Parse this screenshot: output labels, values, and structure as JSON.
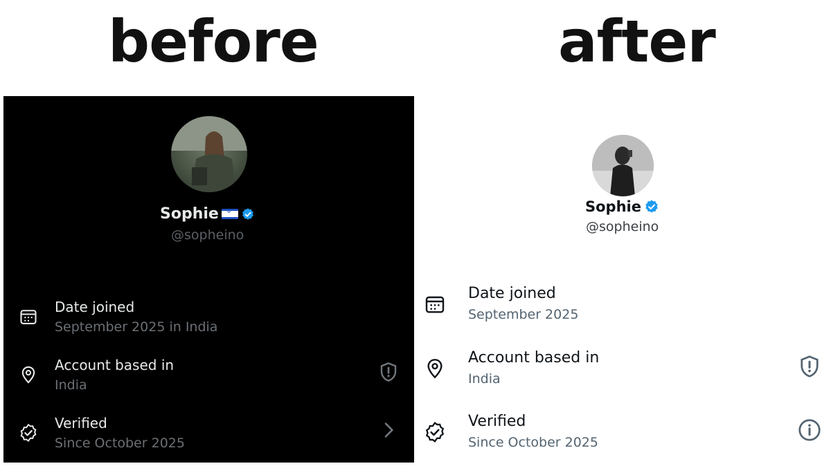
{
  "headings": {
    "before": "before",
    "after": "after"
  },
  "before": {
    "name": "Sophie",
    "flag_icon": "israel-flag-icon",
    "handle": "@sopheino",
    "rows": [
      {
        "icon": "calendar-icon",
        "label": "Date joined",
        "value": "September 2025 in India"
      },
      {
        "icon": "location-pin-icon",
        "label": "Account based in",
        "value": "India",
        "action_icon": "shield-alert-icon"
      },
      {
        "icon": "verified-check-icon",
        "label": "Verified",
        "value": "Since October 2025",
        "action_icon": "chevron-right-icon"
      }
    ]
  },
  "after": {
    "name": "Sophie",
    "handle": "@sopheino",
    "rows": [
      {
        "icon": "calendar-icon",
        "label": "Date joined",
        "value": "September 2025"
      },
      {
        "icon": "location-pin-icon",
        "label": "Account based in",
        "value": "India",
        "action_icon": "shield-alert-icon"
      },
      {
        "icon": "verified-check-icon",
        "label": "Verified",
        "value": "Since October 2025",
        "action_icon": "info-icon"
      }
    ]
  },
  "colors": {
    "verified_blue": "#1d9bf0",
    "dark_bg": "#000000",
    "light_bg": "#ffffff"
  }
}
